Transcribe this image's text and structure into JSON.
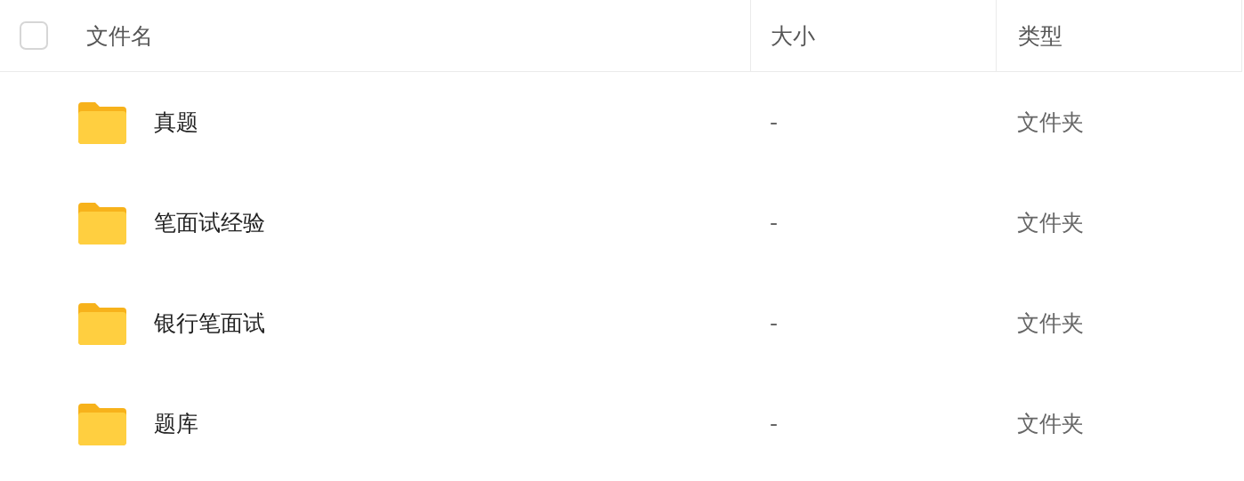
{
  "table": {
    "select_all": {
      "checked": false
    },
    "columns": [
      "文件名",
      "大小",
      "类型"
    ],
    "rows": [
      {
        "name": "真题",
        "size": "-",
        "type": "文件夹"
      },
      {
        "name": "笔面试经验",
        "size": "-",
        "type": "文件夹"
      },
      {
        "name": "银行笔面试",
        "size": "-",
        "type": "文件夹"
      },
      {
        "name": "题库",
        "size": "-",
        "type": "文件夹"
      }
    ]
  }
}
